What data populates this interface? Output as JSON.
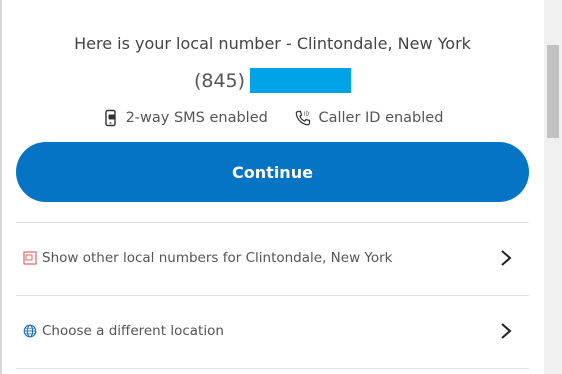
{
  "header": {
    "title": "Here is your local number - Clintondale, New York"
  },
  "number": {
    "area_code": "(845)",
    "redaction_color": "#00a2e8"
  },
  "features": [
    {
      "icon": "phone-sms-icon",
      "label": "2-way SMS enabled"
    },
    {
      "icon": "caller-id-icon",
      "label": "Caller ID enabled"
    }
  ],
  "continue_button": {
    "label": "Continue",
    "color": "#0574c4"
  },
  "options": [
    {
      "icon": "numbers-list-icon",
      "label": "Show other local numbers for Clintondale, New York",
      "icon_color": "#e06666"
    },
    {
      "icon": "globe-icon",
      "label": "Choose a different location",
      "icon_color": "#1f6fb7"
    }
  ]
}
